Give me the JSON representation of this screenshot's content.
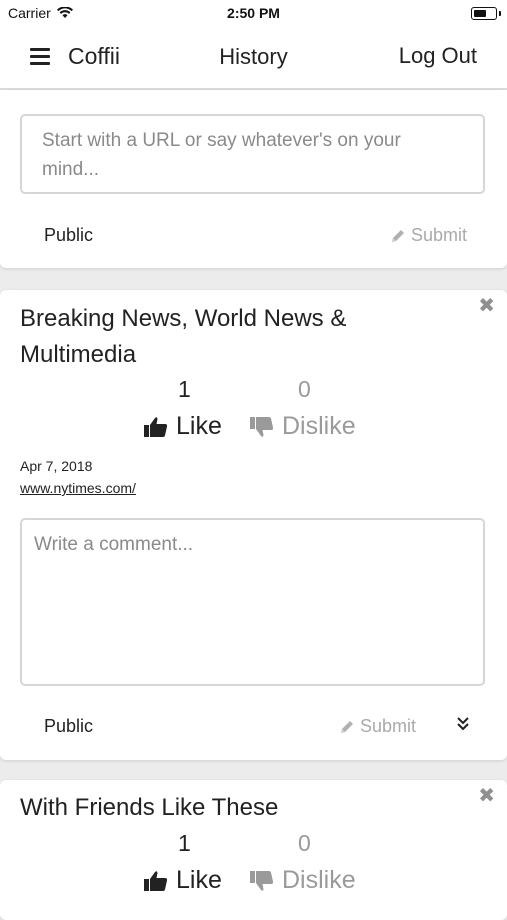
{
  "status_bar": {
    "carrier": "Carrier",
    "time": "2:50 PM",
    "battery_level": 0.7
  },
  "nav": {
    "brand": "Coffii",
    "history": "History",
    "logout": "Log Out"
  },
  "composer": {
    "placeholder": "Start with a URL or say whatever's on your mind...",
    "privacy": "Public",
    "submit": "Submit"
  },
  "posts": [
    {
      "title": "Breaking News, World News & Multimedia",
      "like_count": "1",
      "dislike_count": "0",
      "like_label": "Like",
      "dislike_label": "Dislike",
      "date": "Apr 7, 2018",
      "link": "www.nytimes.com/",
      "comment_placeholder": "Write a comment...",
      "privacy": "Public",
      "submit": "Submit"
    },
    {
      "title": "With Friends Like These",
      "like_count": "1",
      "dislike_count": "0",
      "like_label": "Like",
      "dislike_label": "Dislike"
    }
  ],
  "icons": {
    "menu": "hamburger-icon",
    "close": "close-icon",
    "like": "thumbs-up-icon",
    "dislike": "thumbs-down-icon",
    "submit": "pencil-icon",
    "expand": "double-chevron-down-icon"
  }
}
